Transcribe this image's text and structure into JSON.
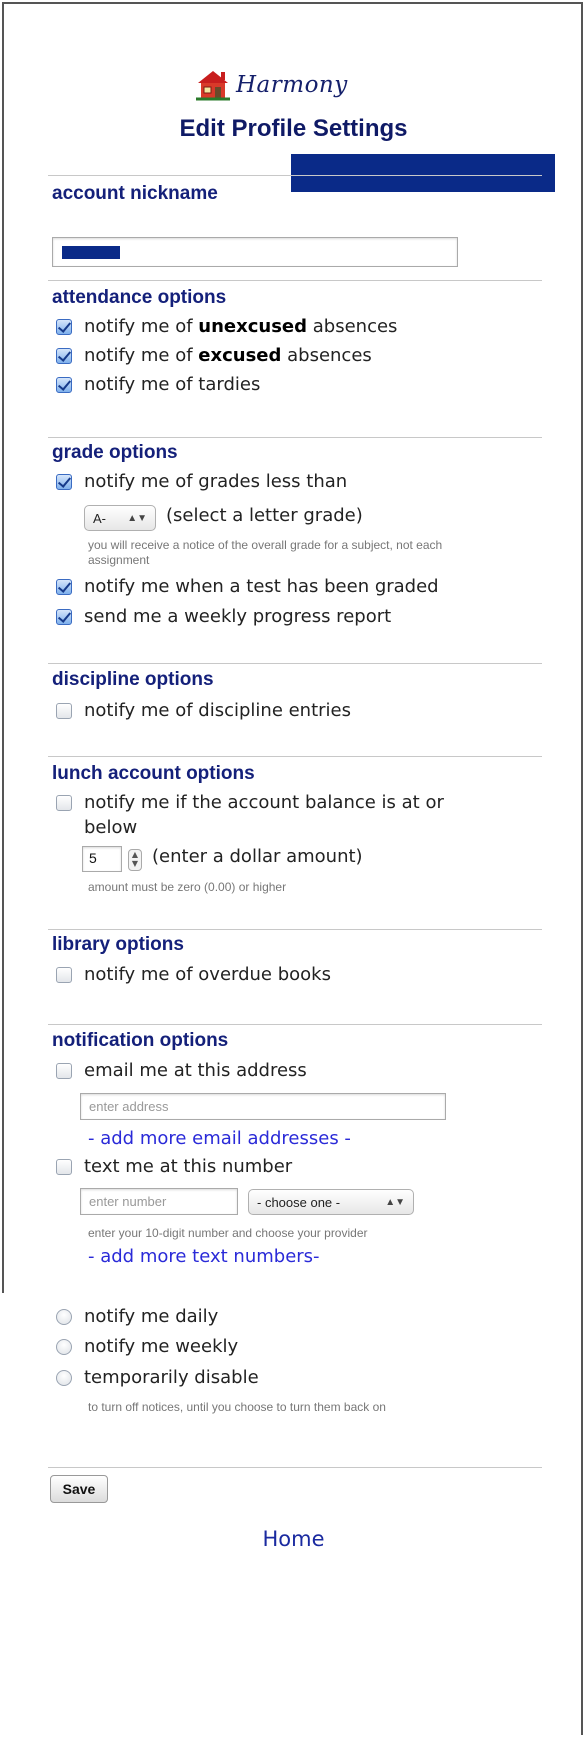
{
  "header": {
    "brand": "Harmony",
    "title": "Edit Profile Settings",
    "bar_color": "#0a2a88"
  },
  "account": {
    "title": "account nickname",
    "nickname_value_redacted": true
  },
  "attendance": {
    "title": "attendance options",
    "unexcused_pre": "notify me of ",
    "unexcused_bold": "unexcused",
    "unexcused_post": " absences",
    "excused_pre": "notify me of ",
    "excused_bold": "excused",
    "excused_post": " absences",
    "tardies": "notify me of tardies"
  },
  "grades": {
    "title": "grade options",
    "less_than": "notify me of grades less than",
    "grade_select": "A-",
    "grade_hint": "(select a letter grade)",
    "note": "you will receive a notice of the overall grade for a subject, not each assignment",
    "test_graded": "notify me when a test has been graded",
    "weekly_report": "send me a weekly progress report"
  },
  "discipline": {
    "title": "discipline options",
    "entries": "notify me of discipline entries"
  },
  "lunch": {
    "title": "lunch account options",
    "balance_line1": "notify me if the account balance is at or",
    "balance_line2": "below",
    "amount": "5",
    "amount_hint": "(enter a dollar amount)",
    "note": "amount must be zero (0.00) or higher"
  },
  "library": {
    "title": "library options",
    "overdue": "notify me of overdue books"
  },
  "notification": {
    "title": "notification options",
    "email": "email me at this address",
    "email_placeholder": "enter address",
    "add_email": "- add more email addresses -",
    "text": "text me at this number",
    "number_placeholder": "enter number",
    "provider_select": "- choose one -",
    "text_note": "enter your 10-digit number and choose your provider",
    "add_text": "- add more text numbers-",
    "daily": "notify me daily",
    "weekly": "notify me weekly",
    "disable": "temporarily disable",
    "disable_note": "to turn off notices, until you choose to turn them back on"
  },
  "actions": {
    "save": "Save",
    "home": "Home"
  }
}
